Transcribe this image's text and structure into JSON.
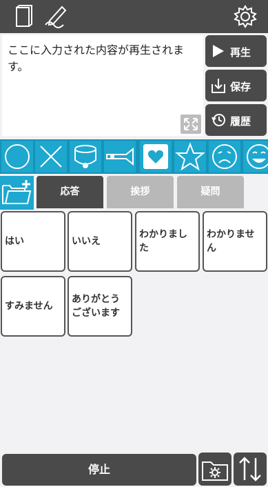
{
  "topbar": {
    "left_icons": [
      "book-icon",
      "pen-note-icon"
    ],
    "right_icon": "gear-icon"
  },
  "input": {
    "text": "ここに入力された内容が再生されます。"
  },
  "side_buttons": [
    {
      "label": "再生",
      "icon": "play-icon"
    },
    {
      "label": "保存",
      "icon": "save-icon"
    },
    {
      "label": "履歴",
      "icon": "history-icon"
    }
  ],
  "symbol_icons": [
    "circle-icon",
    "cross-icon",
    "drum-icon",
    "horn-icon",
    "heart-icon",
    "star-icon",
    "sad-face-icon",
    "happy-face-icon"
  ],
  "tabs": [
    {
      "label": "応答",
      "active": true
    },
    {
      "label": "挨拶",
      "active": false
    },
    {
      "label": "疑問",
      "active": false
    }
  ],
  "phrases": [
    "はい",
    "いいえ",
    "わかりました",
    "わかりません",
    "すみません",
    "ありがとうございます"
  ],
  "bottom": {
    "stop_label": "停止"
  },
  "colors": {
    "dark": "#4a4a4a",
    "accent": "#1ea7cf",
    "tab_inactive": "#b8b8b8"
  }
}
